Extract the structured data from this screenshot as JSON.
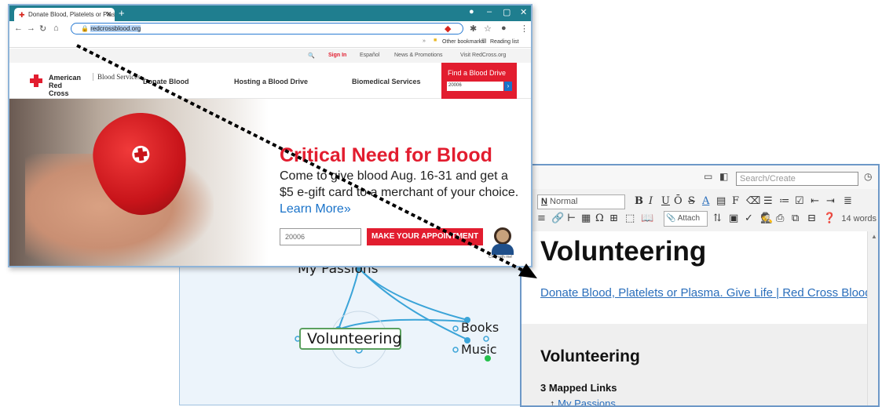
{
  "browser": {
    "tab_title": "Donate Blood, Platelets or Plasm",
    "url": "redcrossblood.org",
    "bookmarks": [
      "Other bookmarks",
      "Reading list"
    ],
    "utility_links": [
      "Sign In",
      "Español",
      "News & Promotions",
      "Visit RedCross.org"
    ],
    "logo_line1": "American Red Cross",
    "logo_line2": "Blood Services",
    "nav": [
      "Donate Blood",
      "Hosting a Blood Drive",
      "Biomedical Services"
    ],
    "find_label": "Find a Blood Drive",
    "find_zip": "20006",
    "hero_heading": "Critical Need for Blood",
    "hero_text": "Come to give blood Aug. 16-31 and get a $5 e-gift card to a merchant of your choice.",
    "hero_link": "Learn More»",
    "zip_value": "20006",
    "appointment_button": "MAKE YOUR APPOINTMENT",
    "chat_label": "Chat with me!"
  },
  "mindmap": {
    "root": "My Passions",
    "nodes": [
      "Volunteering",
      "Books",
      "Music"
    ]
  },
  "editor": {
    "search_placeholder": "Search/Create",
    "style_select": "Normal",
    "attach_label": "Attach",
    "word_count": "14 words",
    "title": "Volunteering",
    "link_text": "Donate Blood, Platelets or Plasma. Give Life | Red Cross Blood",
    "section_heading": "Volunteering",
    "mapped_links_heading": "3 Mapped Links",
    "mapped_link_item": "My Passions",
    "mapped_link_marker": "↑"
  },
  "colors": {
    "brand_red": "#e21d2f",
    "link_blue": "#2a6ebb",
    "titlebar_teal": "#1f7e8f"
  }
}
